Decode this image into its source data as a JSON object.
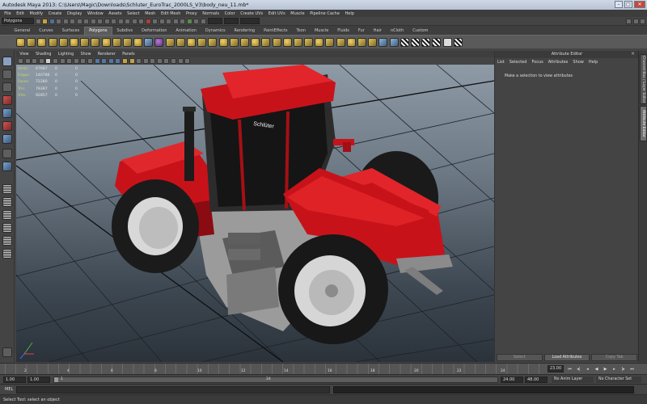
{
  "window": {
    "title": "Autodesk Maya 2013: C:\\Users\\Magic\\Downloads\\Schluter_EuroTrac_2000LS_V3\\body_neu_11.mb*"
  },
  "menus": [
    "File",
    "Edit",
    "Modify",
    "Create",
    "Display",
    "Window",
    "Assets",
    "Select",
    "Mesh",
    "Edit Mesh",
    "Proxy",
    "Normals",
    "Color",
    "Create UVs",
    "Edit UVs",
    "Muscle",
    "Pipeline Cache",
    "Help"
  ],
  "status": {
    "mode": "Polygons"
  },
  "shelf_tabs": [
    "General",
    "Curves",
    "Surfaces",
    "Polygons",
    "Subdivs",
    "Deformation",
    "Animation",
    "Dynamics",
    "Rendering",
    "PaintEffects",
    "Toon",
    "Muscle",
    "Fluids",
    "Fur",
    "Hair",
    "nCloth",
    "Custom"
  ],
  "shelf_tab_active": "Polygons",
  "viewport": {
    "menu": [
      "View",
      "Shading",
      "Lighting",
      "Show",
      "Renderer",
      "Panels"
    ],
    "hud": [
      {
        "label": "Verts:",
        "value": "67687",
        "v2": "0",
        "v3": "0"
      },
      {
        "label": "Edges:",
        "value": "140786",
        "v2": "0",
        "v3": "0"
      },
      {
        "label": "Faces:",
        "value": "72280",
        "v2": "0",
        "v3": "0"
      },
      {
        "label": "Tris:",
        "value": "79397",
        "v2": "0",
        "v3": "0"
      },
      {
        "label": "UVs:",
        "value": "92857",
        "v2": "0",
        "v3": "0"
      }
    ],
    "model_text": "Schlüter",
    "colors": {
      "body": "#c8121a",
      "tire": "#1c1c1c",
      "rim": "#d6d6d6"
    }
  },
  "attribute_editor": {
    "title": "Attribute Editor",
    "menu": [
      "List",
      "Selected",
      "Focus",
      "Attributes",
      "Show",
      "Help"
    ],
    "message": "Make a selection to view attributes",
    "buttons": [
      "Select",
      "Load Attributes",
      "Copy Tab"
    ]
  },
  "side_tabs": [
    "Channel Box / Layer Editor",
    "Attribute Editor"
  ],
  "timeline": {
    "ticks": [
      "2",
      "4",
      "6",
      "8",
      "10",
      "12",
      "14",
      "16",
      "18",
      "20",
      "22",
      "24"
    ],
    "current_frame": "23.00"
  },
  "range": {
    "start": "1.00",
    "start2": "1.00",
    "slider_start": "1",
    "slider_end": "24",
    "end": "24.00",
    "end2": "48.00",
    "anim_layer": "No Anim Layer",
    "char_set": "No Character Set"
  },
  "command": {
    "label": "MEL"
  },
  "help": {
    "text": "Select Tool: select an object"
  }
}
